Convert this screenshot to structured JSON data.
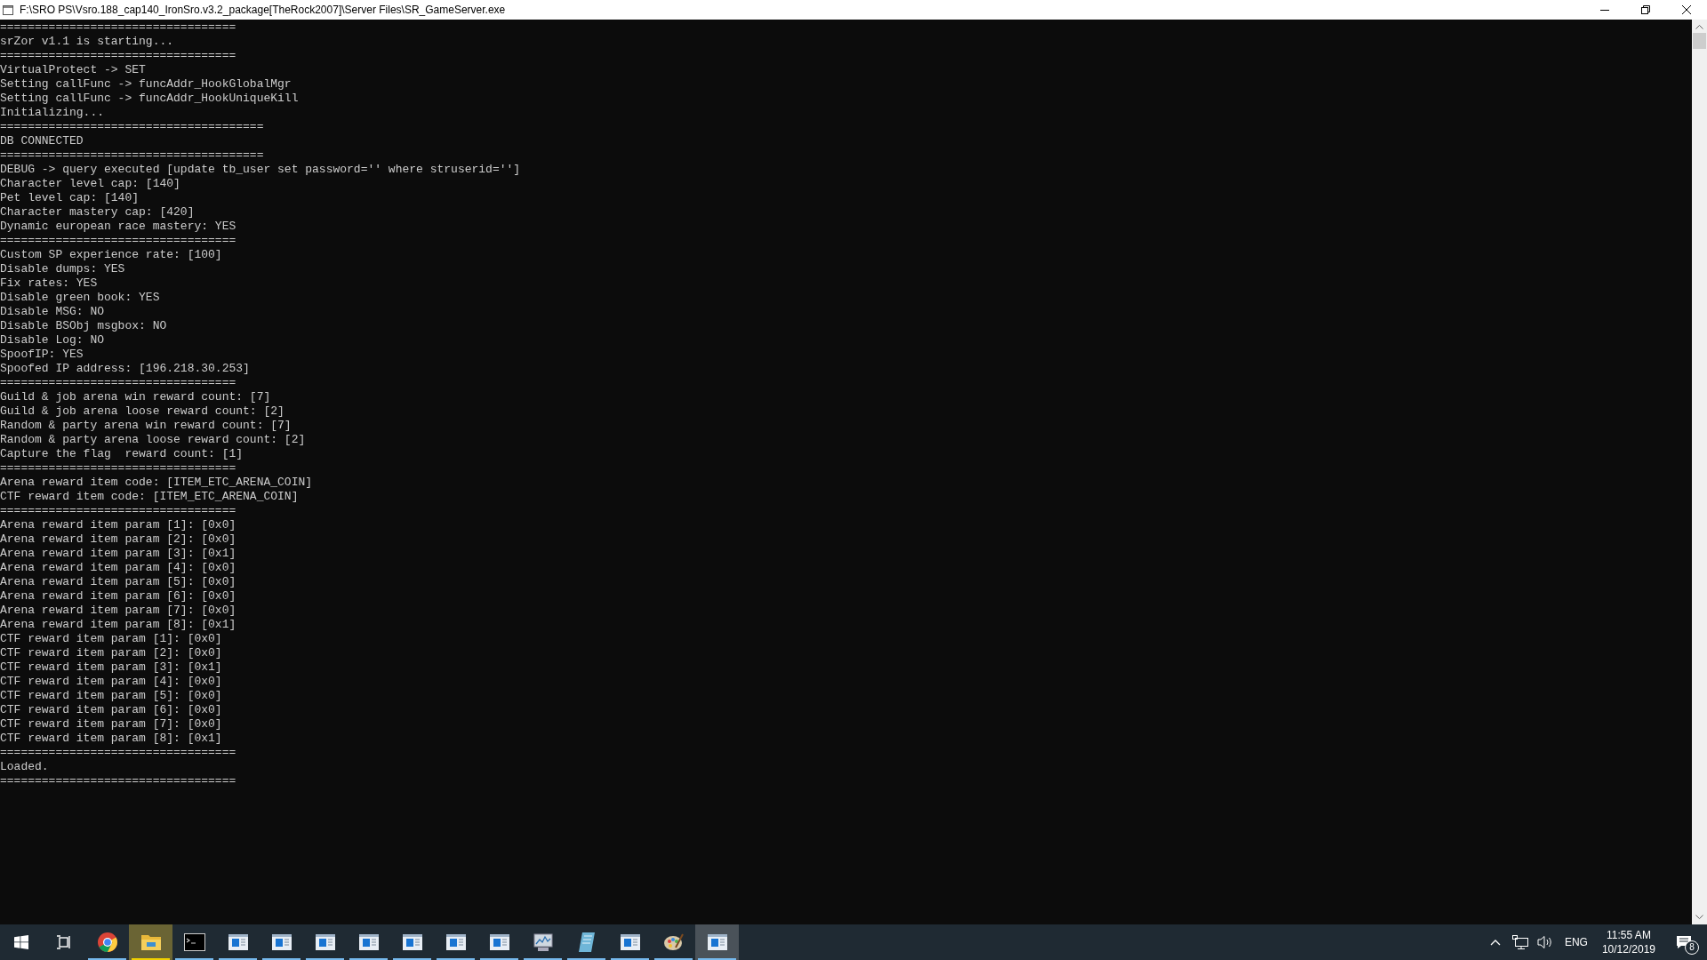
{
  "window": {
    "title": "F:\\SRO PS\\Vsro.188_cap140_IronSro.v3.2_package[TheRock2007]\\Server Files\\SR_GameServer.exe"
  },
  "console_lines": [
    "==================================",
    "srZor v1.1 is starting...",
    "==================================",
    "VirtualProtect -> SET",
    "Setting callFunc -> funcAddr_HookGlobalMgr",
    "Setting callFunc -> funcAddr_HookUniqueKill",
    "Initializing...",
    "======================================",
    "DB CONNECTED",
    "======================================",
    "DEBUG -> query executed [update tb_user set password='' where struserid='']",
    "Character level cap: [140]",
    "Pet level cap: [140]",
    "Character mastery cap: [420]",
    "Dynamic european race mastery: YES",
    "==================================",
    "Custom SP experience rate: [100]",
    "Disable dumps: YES",
    "Fix rates: YES",
    "Disable green book: YES",
    "Disable MSG: NO",
    "Disable BSObj msgbox: NO",
    "Disable Log: NO",
    "SpoofIP: YES",
    "Spoofed IP address: [196.218.30.253]",
    "==================================",
    "Guild & job arena win reward count: [7]",
    "Guild & job arena loose reward count: [2]",
    "Random & party arena win reward count: [7]",
    "Random & party arena loose reward count: [2]",
    "Capture the flag  reward count: [1]",
    "==================================",
    "Arena reward item code: [ITEM_ETC_ARENA_COIN]",
    "CTF reward item code: [ITEM_ETC_ARENA_COIN]",
    "==================================",
    "Arena reward item param [1]: [0x0]",
    "Arena reward item param [2]: [0x0]",
    "Arena reward item param [3]: [0x1]",
    "Arena reward item param [4]: [0x0]",
    "Arena reward item param [5]: [0x0]",
    "Arena reward item param [6]: [0x0]",
    "Arena reward item param [7]: [0x0]",
    "Arena reward item param [8]: [0x1]",
    "CTF reward item param [1]: [0x0]",
    "CTF reward item param [2]: [0x0]",
    "CTF reward item param [3]: [0x1]",
    "CTF reward item param [4]: [0x0]",
    "CTF reward item param [5]: [0x0]",
    "CTF reward item param [6]: [0x0]",
    "CTF reward item param [7]: [0x0]",
    "CTF reward item param [8]: [0x1]",
    "==================================",
    "Loaded.",
    "=================================="
  ],
  "taskbar": {
    "items": [
      {
        "kind": "start",
        "running": false,
        "selected": false,
        "flashing": false
      },
      {
        "kind": "taskview",
        "running": false,
        "selected": false,
        "flashing": false
      },
      {
        "kind": "browser",
        "running": true,
        "selected": false,
        "flashing": false
      },
      {
        "kind": "folder",
        "running": true,
        "selected": false,
        "flashing": true
      },
      {
        "kind": "terminal",
        "running": true,
        "selected": false,
        "flashing": false
      },
      {
        "kind": "console",
        "running": true,
        "selected": false,
        "flashing": false
      },
      {
        "kind": "console",
        "running": true,
        "selected": false,
        "flashing": false
      },
      {
        "kind": "console",
        "running": true,
        "selected": false,
        "flashing": false
      },
      {
        "kind": "console",
        "running": true,
        "selected": false,
        "flashing": false
      },
      {
        "kind": "console",
        "running": true,
        "selected": false,
        "flashing": false
      },
      {
        "kind": "console",
        "running": true,
        "selected": false,
        "flashing": false
      },
      {
        "kind": "console",
        "running": true,
        "selected": false,
        "flashing": false
      },
      {
        "kind": "monitor",
        "running": true,
        "selected": false,
        "flashing": false
      },
      {
        "kind": "notepad",
        "running": true,
        "selected": false,
        "flashing": false
      },
      {
        "kind": "console",
        "running": true,
        "selected": false,
        "flashing": false
      },
      {
        "kind": "paint",
        "running": true,
        "selected": false,
        "flashing": false
      },
      {
        "kind": "console",
        "running": true,
        "selected": true,
        "flashing": false
      }
    ],
    "tray": {
      "language": "ENG",
      "time": "11:55 AM",
      "date": "10/12/2019",
      "notification_count": "8"
    }
  }
}
